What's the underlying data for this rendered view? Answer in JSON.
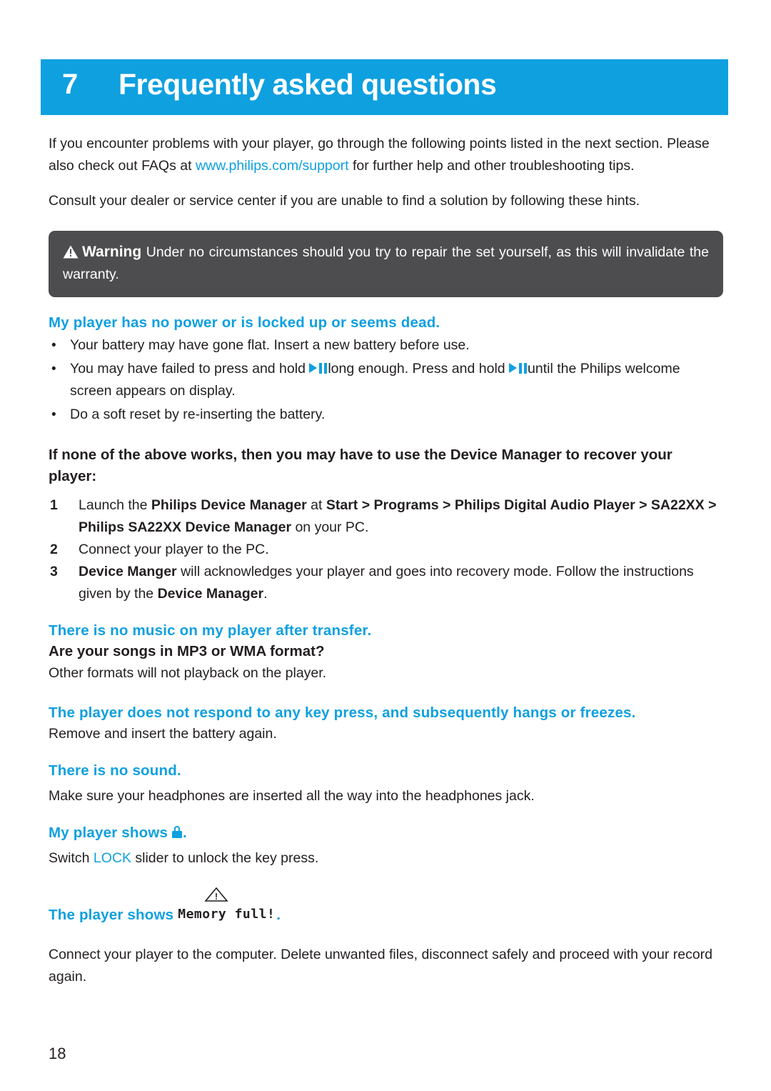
{
  "chapter": {
    "number": "7",
    "title": "Frequently asked questions"
  },
  "intro": {
    "p1_before": "If you encounter problems with your player, go through the following points listed in the next section. Please also check out FAQs at ",
    "p1_link": "www.philips.com/support",
    "p1_after": " for further help and other troubleshooting tips.",
    "p2": "Consult your dealer or service center if you are unable to find a solution by following these hints."
  },
  "warning": {
    "icon": "warning-triangle-icon",
    "label": "Warning",
    "text": "Under no circumstances should you try to repair the set yourself, as this will invalidate the warranty."
  },
  "sections": [
    {
      "heading": "My player has no power or is locked up or seems dead.",
      "bullets": [
        "Your battery may have gone flat. Insert a new battery before use.",
        "You may have failed to press and hold  long enough. Press and hold  until the Philips welcome screen appears on display.",
        "Do a soft reset by re-inserting the battery."
      ]
    }
  ],
  "device_manager": {
    "heading": "If none of the above works, then you may have to use the Device Manager to recover your player:",
    "steps": [
      {
        "n": "1",
        "parts": [
          "Launch the ",
          "Philips Device Manager",
          " at ",
          "Start",
          " > ",
          "Programs",
          " > ",
          "Philips Digital Audio Player",
          " > ",
          "SA22XX",
          " > ",
          "Philips SA22XX Device Manager",
          " on your PC."
        ]
      },
      {
        "n": "2",
        "text": "Connect your player to the PC."
      },
      {
        "n": "3",
        "parts": [
          "Device Manger",
          " will acknowledges your player and goes into recovery mode. Follow the instructions given by the ",
          "Device Manager",
          "."
        ]
      }
    ]
  },
  "no_music": {
    "heading": "There is no music on my player after transfer.",
    "subheading": "Are your songs in MP3 or WMA format?",
    "body": "Other formats will not playback on the player."
  },
  "no_respond": {
    "heading": "The player does not respond to any key press, and subsequently hangs or freezes.",
    "body": "Remove and insert the battery again."
  },
  "no_sound": {
    "heading": "There is no sound.",
    "body": "Make sure your headphones are inserted all the way into the headphones jack."
  },
  "lock_section": {
    "heading_before": "My player shows ",
    "heading_icon": "lock-icon",
    "heading_after": ".",
    "body_before": "Switch ",
    "body_lock": "LOCK",
    "body_after": " slider to unlock the key press."
  },
  "memory_full": {
    "heading_before": "The player shows",
    "graphic_icon": "warning-triangle-icon",
    "graphic_text": "Memory full!",
    "heading_after": ".",
    "body": "Connect your player to the computer. Delete unwanted files, disconnect safely and proceed with your record again."
  },
  "page_number": "18"
}
